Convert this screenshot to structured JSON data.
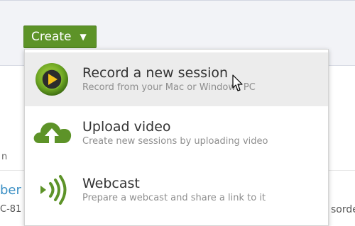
{
  "toolbar": {
    "create_label": "Create",
    "create_caret": "▼"
  },
  "background": {
    "text_n": "n",
    "text_ber": "ber",
    "text_num": "C-81",
    "text_sorde": "sorde"
  },
  "menu": {
    "items": [
      {
        "title": "Record a new session",
        "description": "Record from your Mac or Windows PC",
        "icon": "record-play-icon"
      },
      {
        "title": "Upload video",
        "description": "Create new sessions by uploading video",
        "icon": "cloud-upload-icon"
      },
      {
        "title": "Webcast",
        "description": "Prepare a webcast and share a link to it",
        "icon": "webcast-icon"
      }
    ]
  },
  "colors": {
    "accent_green": "#5d9328",
    "highlight": "#ececec"
  }
}
